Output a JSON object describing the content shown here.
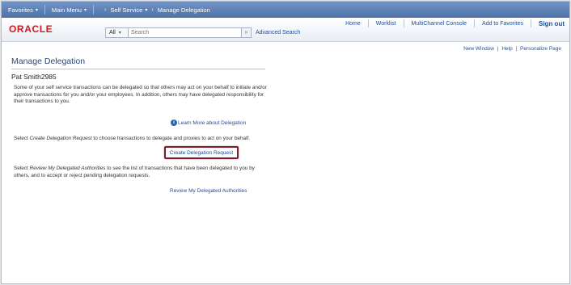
{
  "nav": {
    "favorites": "Favorites",
    "main_menu": "Main Menu",
    "crumb_arrow": "›",
    "self_service": "Self Service",
    "current": "Manage Delegation",
    "caret": "▾"
  },
  "header": {
    "logo": "ORACLE",
    "search_scope": "All",
    "search_placeholder": "Search",
    "search_go": "»",
    "advanced_search": "Advanced Search",
    "links": [
      "Home",
      "Worklist",
      "MultiChannel Console",
      "Add to Favorites"
    ],
    "sign_out": "Sign out"
  },
  "page_links": {
    "new_window": "New Window",
    "help": "Help",
    "personalize": "Personalize Page",
    "sep": "|"
  },
  "content": {
    "title": "Manage Delegation",
    "user": "Pat Smith2985",
    "intro": "Some of your self service transactions can be delegated so that others may act on your behalf to initiate and/or approve transactions for you and/or your employees. In addition, others may have delegated responsibility for their transactions to you.",
    "learn_icon": "i",
    "learn_more": "Learn More about Delegation",
    "select_create_pre": "Select ",
    "select_create_em": "Create Delegation Request",
    "select_create_post": " to choose transactions to delegate and proxies to act on your behalf.",
    "create_button": "Create Delegation Request",
    "select_review_pre": "Select ",
    "select_review_em": "Review My Delegated Authorities",
    "select_review_post": " to see the list of transactions that have been delegated to you by others, and to accept or reject pending delegation requests.",
    "review_link": "Review My Delegated Authorities"
  }
}
